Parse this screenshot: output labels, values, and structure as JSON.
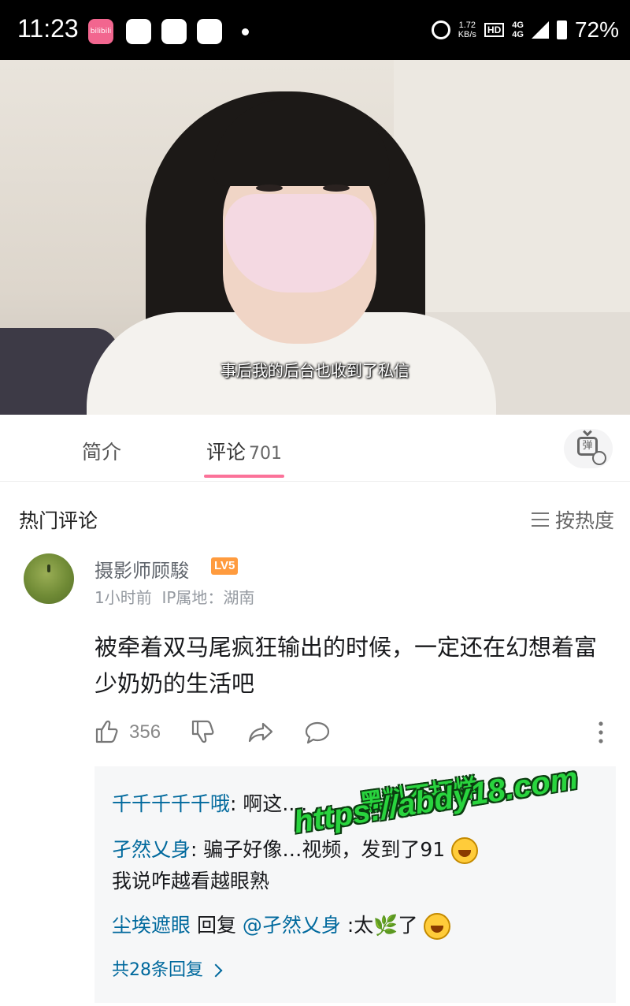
{
  "status_bar": {
    "time": "11:23",
    "app_icon_label": "bilibili",
    "net_speed": "1.72",
    "net_speed_unit": "KB/s",
    "hd_label": "HD",
    "network": "4G",
    "battery": "72%"
  },
  "video": {
    "subtitle": "事后我的后台也收到了私信",
    "progress_fraction": 0.0
  },
  "tabs": {
    "intro": "简介",
    "comments": "评论",
    "comments_count": "701",
    "danmaku_icon_text": "弹"
  },
  "section": {
    "title": "热门评论",
    "sort_label": "按热度"
  },
  "comment": {
    "username": "摄影师顾駿",
    "level": "LV5",
    "time": "1小时前",
    "ip": "IP属地：湖南",
    "text": "被牵着双马尾疯狂输出的时候，一定还在幻想着富少奶奶的生活吧",
    "like_count": "356"
  },
  "replies": [
    {
      "user": "千千千千千哦",
      "text": ": 啊这...."
    },
    {
      "user": "孑然乂身",
      "text": ": 骗子好像…视频，发到了91",
      "text2": "我说咋越看越眼熟"
    },
    {
      "user": "尘埃遮眼",
      "reply_word": " 回复 ",
      "at": "@孑然乂身",
      "text": " :太",
      "leaf": "🌿",
      "text_end": "了"
    }
  ],
  "more_replies": "共28条回复",
  "watermark": {
    "line1": "黑料不打烊",
    "line2": "https://abdy18.com"
  }
}
